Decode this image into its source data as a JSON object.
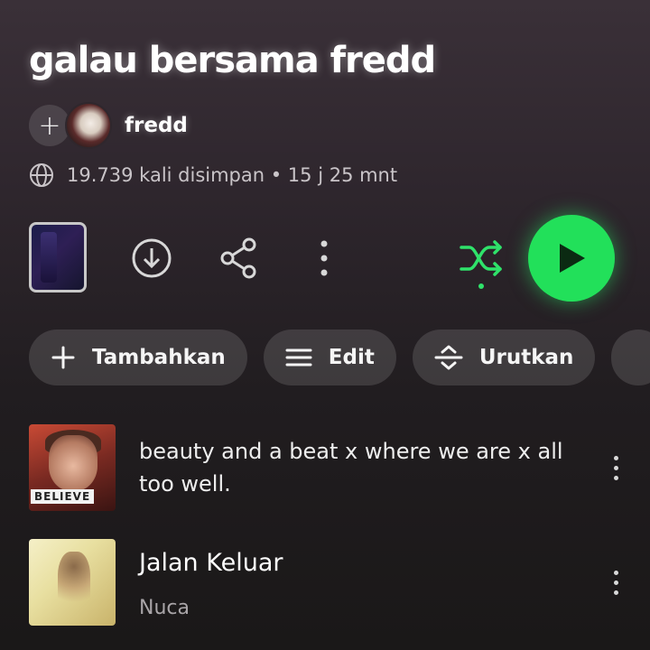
{
  "playlist": {
    "title": "galau bersama fredd",
    "owner": "fredd",
    "meta": "19.739 kali disimpan • 15 j 25 mnt"
  },
  "actions": {
    "download": "download-icon",
    "share": "share-icon",
    "more": "more-vertical-icon",
    "shuffle": "shuffle-icon",
    "play": "play-icon"
  },
  "chips": [
    {
      "label": "Tambahkan",
      "icon": "plus-icon"
    },
    {
      "label": "Edit",
      "icon": "menu-lines-icon"
    },
    {
      "label": "Urutkan",
      "icon": "sort-icon"
    }
  ],
  "tracks": [
    {
      "title": "beauty and a beat x where we are x all too well.",
      "artist": "",
      "cover_text": "BELIEVE"
    },
    {
      "title": "Jalan Keluar",
      "artist": "Nuca"
    }
  ],
  "colors": {
    "accent": "#22e05a",
    "background_top": "#3a3038",
    "background_bottom": "#1a1818"
  }
}
